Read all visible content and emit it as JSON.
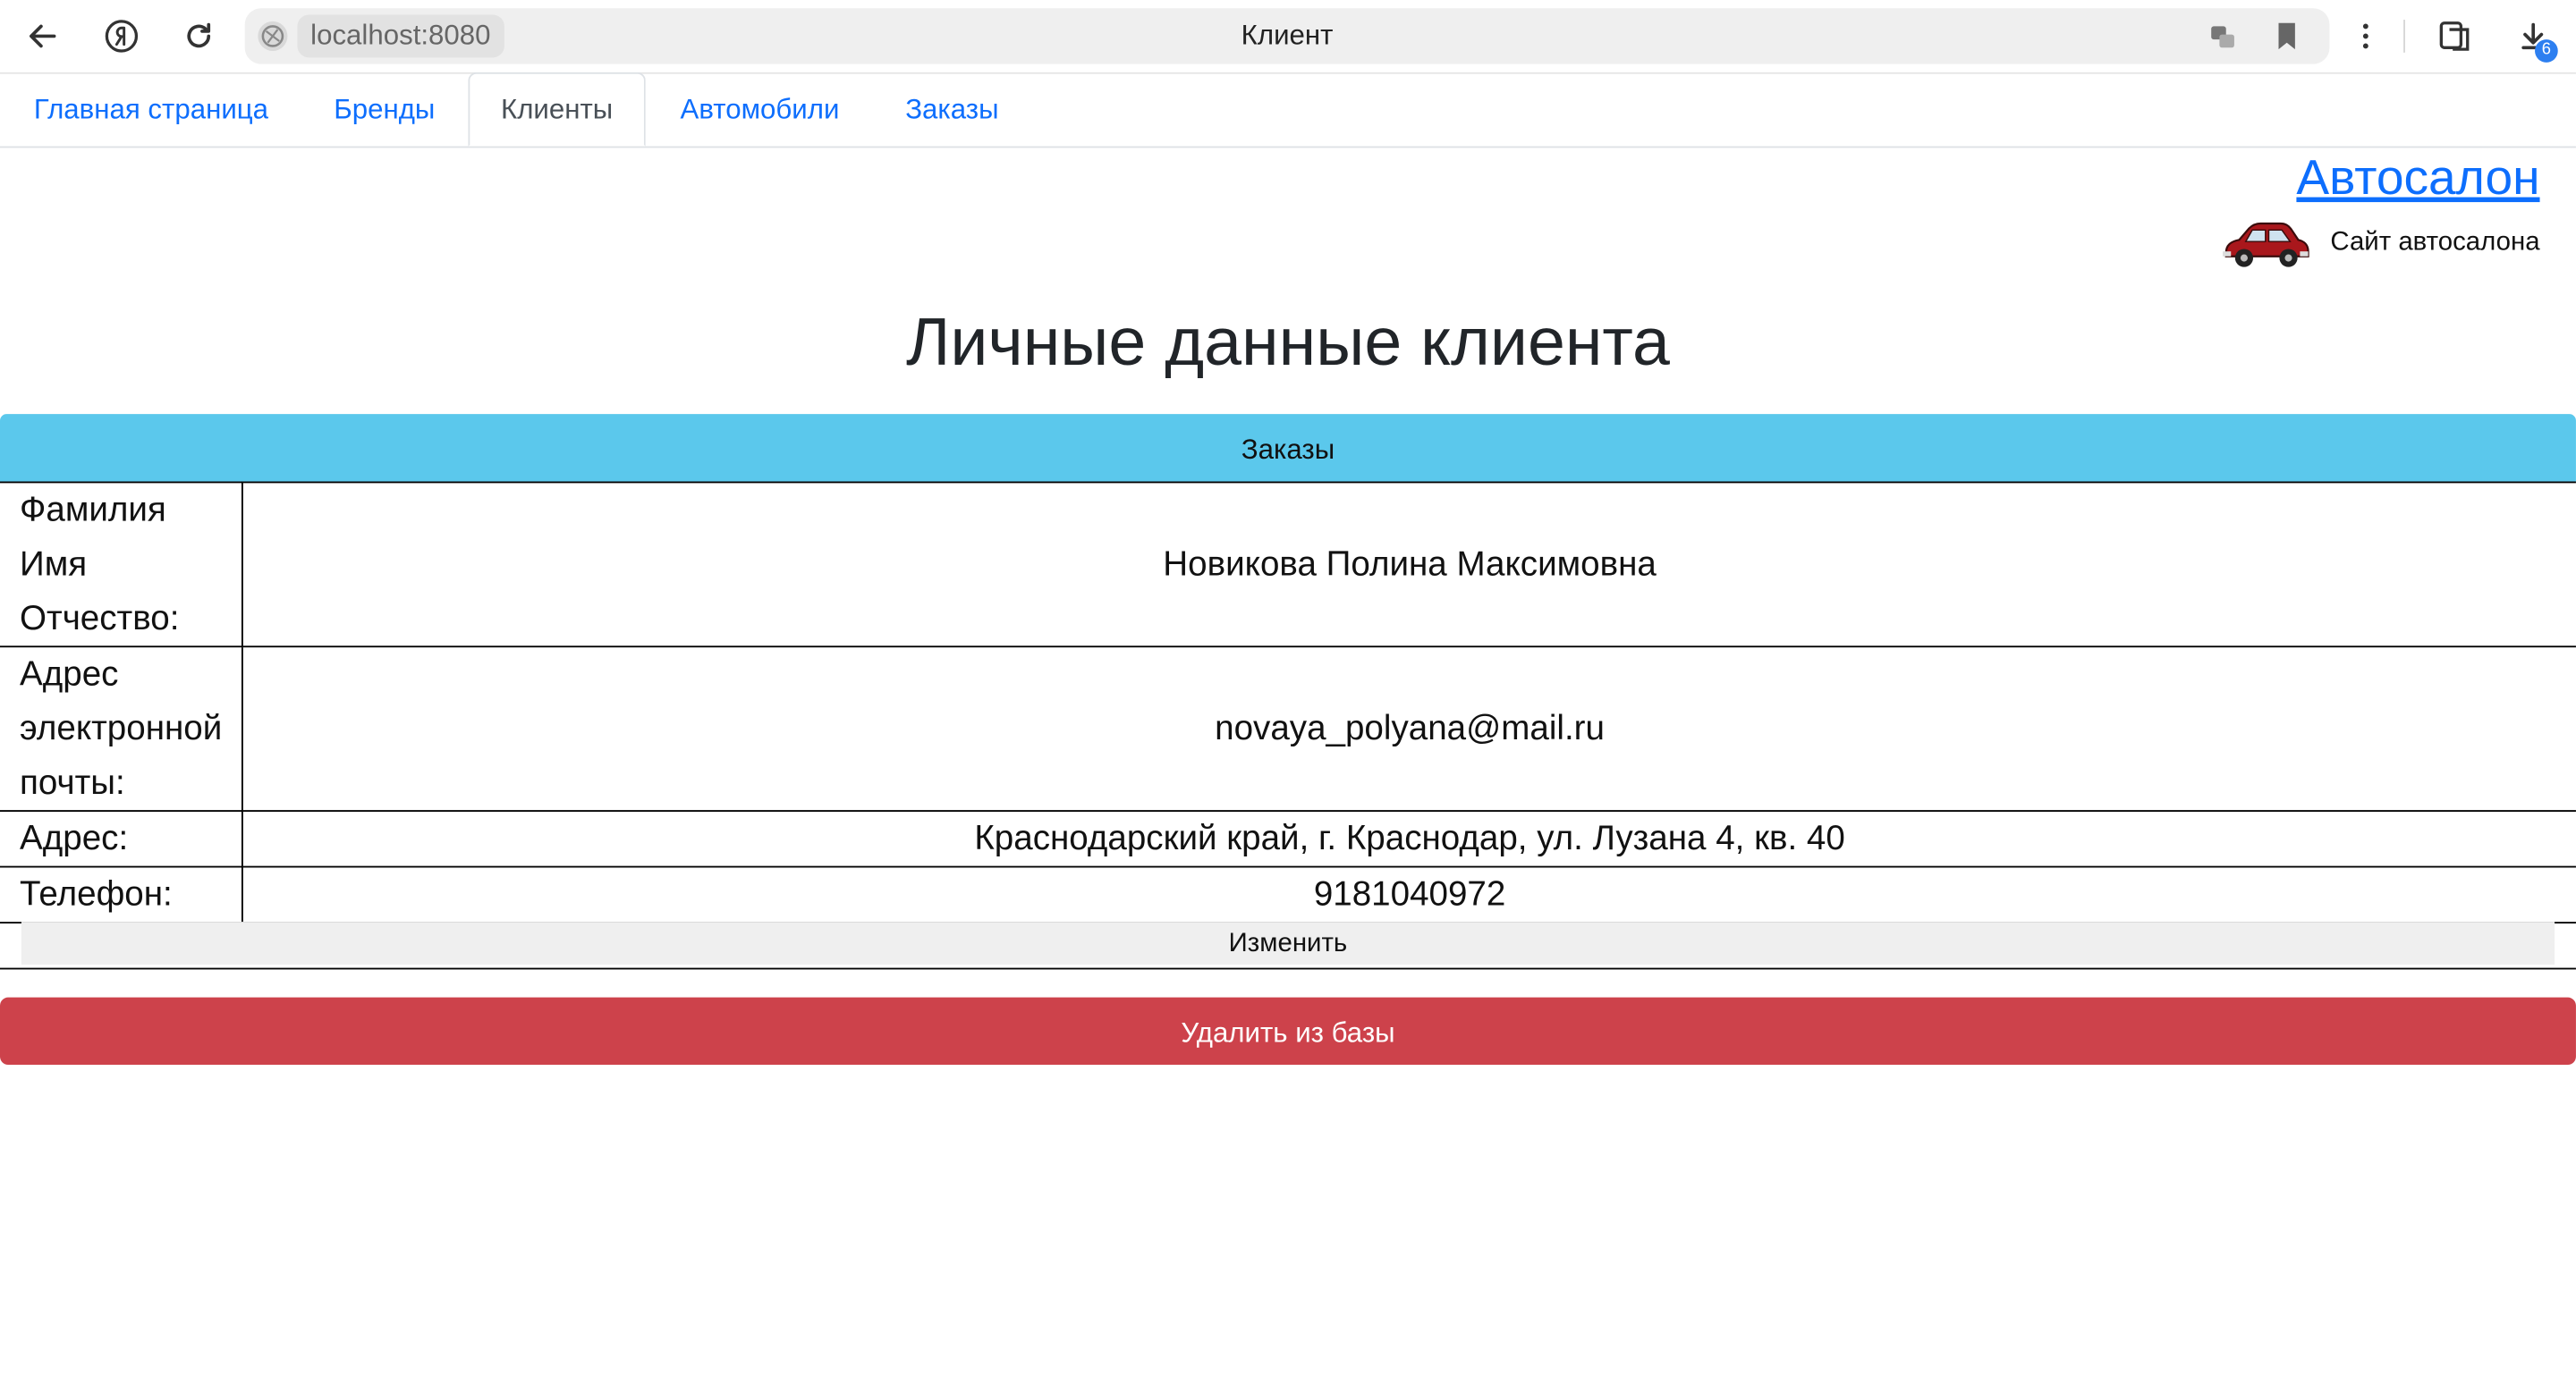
{
  "browser": {
    "url": "localhost:8080",
    "tab_title": "Клиент",
    "downloads_count": "6"
  },
  "nav": {
    "tabs": [
      {
        "label": "Главная страница",
        "active": false
      },
      {
        "label": "Бренды",
        "active": false
      },
      {
        "label": "Клиенты",
        "active": true
      },
      {
        "label": "Автомобили",
        "active": false
      },
      {
        "label": "Заказы",
        "active": false
      }
    ]
  },
  "brand": {
    "name": "Автосалон",
    "caption": "Сайт автосалона"
  },
  "page": {
    "heading": "Личные данные клиента",
    "orders_button": "Заказы"
  },
  "client": {
    "rows": [
      {
        "label": "Фамилия Имя Отчество:",
        "value": "Новикова Полина Максимовна"
      },
      {
        "label": "Адрес электронной почты:",
        "value": "novaya_polyana@mail.ru"
      },
      {
        "label": "Адрес:",
        "value": "Краснодарский край, г. Краснодар, ул. Лузана 4, кв. 40"
      },
      {
        "label": "Телефон:",
        "value": "9181040972"
      }
    ]
  },
  "actions": {
    "edit_label": "Изменить",
    "delete_label": "Удалить из базы"
  },
  "colors": {
    "link": "#0d6efd",
    "orders_button_bg": "#5bc8ec",
    "delete_button_bg": "#cd424b",
    "edit_button_bg": "#efefef"
  }
}
